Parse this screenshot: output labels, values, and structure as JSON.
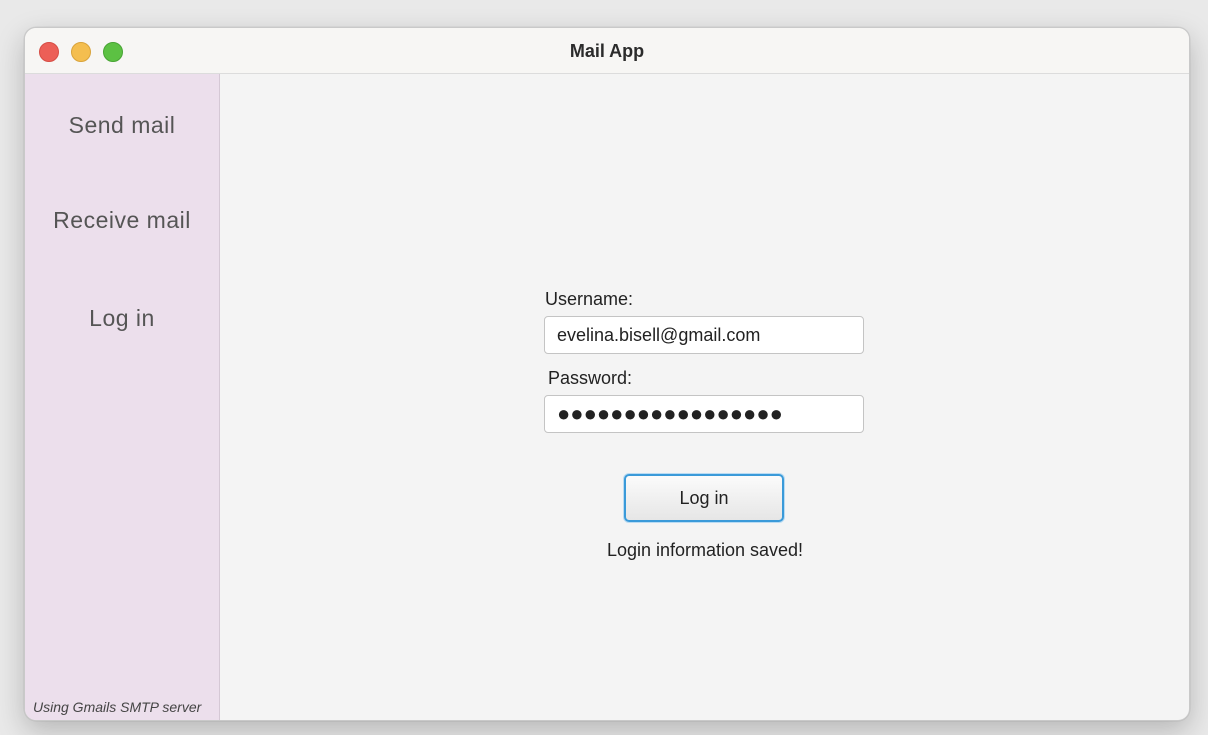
{
  "window": {
    "title": "Mail App"
  },
  "sidebar": {
    "items": [
      {
        "label": "Send mail"
      },
      {
        "label": "Receive mail"
      },
      {
        "label": "Log in"
      }
    ],
    "footer_note": "Using Gmails SMTP server"
  },
  "login_form": {
    "username_label": "Username:",
    "username_value": "evelina.bisell@gmail.com",
    "password_label": "Password:",
    "password_masked": "●●●●●●●●●●●●●●●●●",
    "login_button_label": "Log in",
    "status_message": "Login information saved!"
  },
  "colors": {
    "sidebar_bg": "#ecdfec",
    "focus_border": "#3a9ad9",
    "close": "#ec5f57",
    "minimize": "#f4be4f",
    "zoom": "#5cc143"
  }
}
